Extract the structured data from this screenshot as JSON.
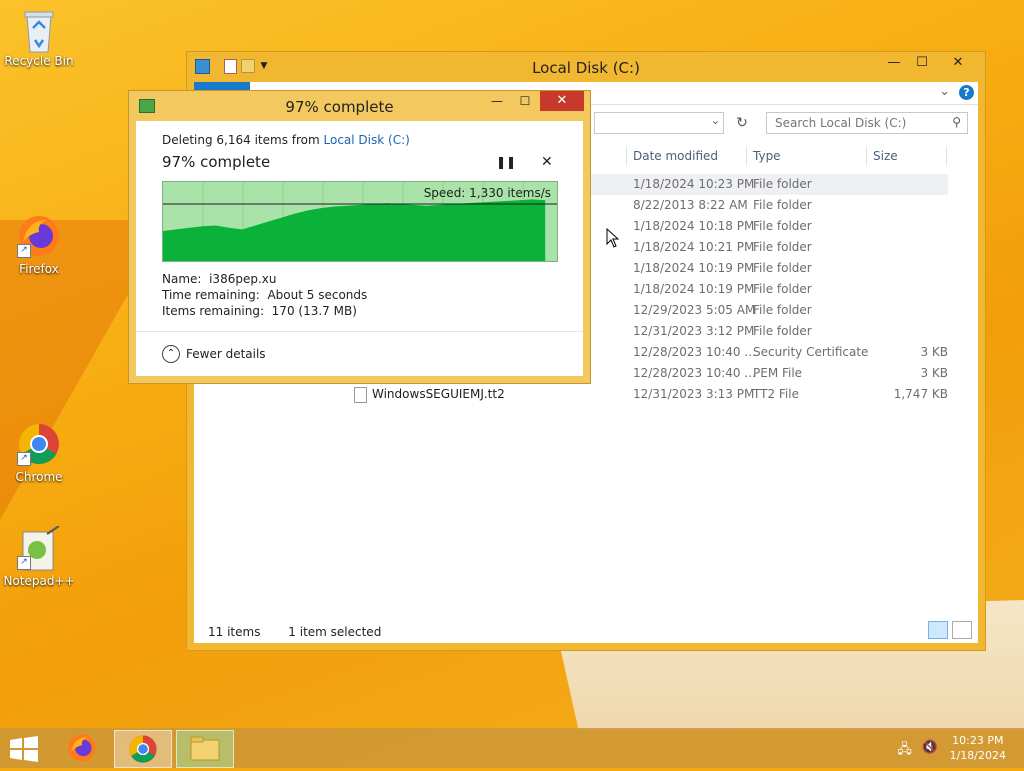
{
  "desktop": {
    "icons": [
      {
        "label": "Recycle Bin",
        "icon": "recycle-bin-icon"
      },
      {
        "label": "Firefox",
        "icon": "firefox-icon"
      },
      {
        "label": "Chrome",
        "icon": "chrome-icon"
      },
      {
        "label": "Notepad++",
        "icon": "notepadpp-icon"
      }
    ]
  },
  "explorer": {
    "title": "Local Disk (C:)",
    "search_placeholder": "Search Local Disk (C:)",
    "columns": {
      "date": "Date modified",
      "type": "Type",
      "size": "Size"
    },
    "rows": [
      {
        "name": "",
        "date": "1/18/2024 10:23 PM",
        "type": "File folder",
        "size": ""
      },
      {
        "name": "",
        "date": "8/22/2013 8:22 AM",
        "type": "File folder",
        "size": ""
      },
      {
        "name": "",
        "date": "1/18/2024 10:18 PM",
        "type": "File folder",
        "size": ""
      },
      {
        "name": "",
        "date": "1/18/2024 10:21 PM",
        "type": "File folder",
        "size": ""
      },
      {
        "name": "",
        "date": "1/18/2024 10:19 PM",
        "type": "File folder",
        "size": ""
      },
      {
        "name": "",
        "date": "1/18/2024 10:19 PM",
        "type": "File folder",
        "size": ""
      },
      {
        "name": "",
        "date": "12/29/2023 5:05 AM",
        "type": "File folder",
        "size": ""
      },
      {
        "name": "",
        "date": "12/31/2023 3:12 PM",
        "type": "File folder",
        "size": ""
      },
      {
        "name": "",
        "date": "12/28/2023 10:40 ...",
        "type": "Security Certificate",
        "size": "3 KB"
      },
      {
        "name": "",
        "date": "12/28/2023 10:40 ...",
        "type": "PEM File",
        "size": "3 KB"
      },
      {
        "name": "WindowsSEGUIEMJ.tt2",
        "date": "12/31/2023 3:13 PM",
        "type": "TT2 File",
        "size": "1,747 KB"
      }
    ],
    "status": {
      "items": "11 items",
      "selected": "1 item selected"
    }
  },
  "dialog": {
    "title": "97% complete",
    "deleting_prefix": "Deleting 6,164 items from ",
    "deleting_link": "Local Disk (C:)",
    "percent_text": "97% complete",
    "progress": 0.97,
    "speed": "Speed: 1,330 items/s",
    "name_label": "Name:",
    "name_value": "i386pep.xu",
    "time_label": "Time remaining:",
    "time_value": "About 5 seconds",
    "items_label": "Items remaining:",
    "items_value": "170 (13.7 MB)",
    "fewer_details": "Fewer details"
  },
  "taskbar": {
    "time": "10:23 PM",
    "date": "1/18/2024"
  },
  "colors": {
    "accent": "#1979ca",
    "progress_green": "#0bb23a",
    "close_red": "#c7392a"
  }
}
